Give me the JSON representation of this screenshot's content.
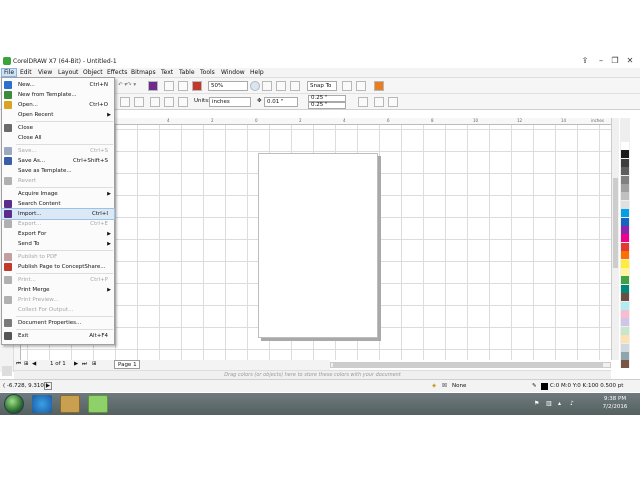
{
  "window": {
    "title": "CorelDRAW X7 (64-Bit) - Untitled-1"
  },
  "menubar": [
    "File",
    "Edit",
    "View",
    "Layout",
    "Object",
    "Effects",
    "Bitmaps",
    "Text",
    "Table",
    "Tools",
    "Window",
    "Help"
  ],
  "toolbar": {
    "zoom": "50%",
    "snap_to": "Snap To",
    "units_label": "Units:",
    "units_value": "inches",
    "nudge": "0.01 \"",
    "dup_x": "0.25 \"",
    "dup_y": "0.25 \""
  },
  "file_menu": [
    {
      "label": "New...",
      "shortcut": "Ctrl+N",
      "icon": "new-document-icon",
      "color": "#2b6fd1"
    },
    {
      "label": "New from Template...",
      "shortcut": "",
      "icon": "template-icon",
      "color": "#3d8a3d"
    },
    {
      "label": "Open...",
      "shortcut": "Ctrl+O",
      "icon": "open-folder-icon",
      "color": "#d9a520"
    },
    {
      "label": "Open Recent",
      "shortcut": "",
      "submenu": true
    },
    {
      "sep": true
    },
    {
      "label": "Close",
      "shortcut": "",
      "icon": "close-doc-icon",
      "color": "#6a6a6a"
    },
    {
      "label": "Close All",
      "shortcut": ""
    },
    {
      "sep": true
    },
    {
      "label": "Save...",
      "shortcut": "Ctrl+S",
      "disabled": true,
      "icon": "save-icon",
      "color": "#9aa8c0"
    },
    {
      "label": "Save As...",
      "shortcut": "Ctrl+Shift+S",
      "icon": "save-as-icon",
      "color": "#3b5da8"
    },
    {
      "label": "Save as Template...",
      "shortcut": ""
    },
    {
      "label": "Revert",
      "shortcut": "",
      "disabled": true,
      "icon": "revert-icon",
      "color": "#b0b0b0"
    },
    {
      "sep": true
    },
    {
      "label": "Acquire Image",
      "shortcut": "",
      "submenu": true
    },
    {
      "label": "Search Content",
      "shortcut": "",
      "icon": "search-content-icon",
      "color": "#5b2d8c"
    },
    {
      "label": "Import...",
      "shortcut": "Ctrl+I",
      "highlight": true,
      "icon": "import-icon",
      "color": "#5b2d8c"
    },
    {
      "label": "Export...",
      "shortcut": "Ctrl+E",
      "disabled": true,
      "icon": "export-icon",
      "color": "#b0b0b0"
    },
    {
      "label": "Export For",
      "shortcut": "",
      "submenu": true
    },
    {
      "label": "Send To",
      "shortcut": "",
      "submenu": true
    },
    {
      "sep": true
    },
    {
      "label": "Publish to PDF",
      "shortcut": "",
      "disabled": true,
      "icon": "pdf-icon",
      "color": "#c0a0a0"
    },
    {
      "label": "Publish Page to ConceptShare...",
      "shortcut": "",
      "icon": "conceptshare-icon",
      "color": "#c0392b"
    },
    {
      "sep": true
    },
    {
      "label": "Print...",
      "shortcut": "Ctrl+P",
      "disabled": true,
      "icon": "print-icon",
      "color": "#b0b0b0"
    },
    {
      "label": "Print Merge",
      "shortcut": "",
      "submenu": true
    },
    {
      "label": "Print Preview...",
      "shortcut": "",
      "disabled": true,
      "icon": "print-preview-icon",
      "color": "#b0b0b0"
    },
    {
      "label": "Collect For Output...",
      "shortcut": "",
      "disabled": true
    },
    {
      "sep": true
    },
    {
      "label": "Document Properties...",
      "shortcut": "",
      "icon": "doc-properties-icon",
      "color": "#7a7a7a"
    },
    {
      "sep": true
    },
    {
      "label": "Exit",
      "shortcut": "Alt+F4",
      "icon": "exit-icon",
      "color": "#555"
    }
  ],
  "ruler": {
    "ticks": [
      "4",
      "2",
      "0",
      "2",
      "4",
      "6",
      "8",
      "10",
      "12",
      "14",
      "16",
      "18",
      "inches"
    ]
  },
  "page_nav": {
    "count": "1 of 1",
    "tab": "Page 1"
  },
  "drag_hint": "Drag colors (or objects) here to store these colors with your document",
  "status": {
    "coords": "( -6.728, 9.310 )",
    "fill": "None",
    "outline": "C:0 M:0 Y:0 K:100  0.500 pt"
  },
  "clock": {
    "time": "9:38 PM",
    "date": "7/2/2016"
  },
  "palette": [
    "#ffffff",
    "#1a1a1a",
    "#3d3d3d",
    "#5e5e5e",
    "#808080",
    "#a0a0a0",
    "#c0c0c0",
    "#e0e0e0",
    "#00a0e9",
    "#1565c0",
    "#8e24aa",
    "#ec008c",
    "#e53935",
    "#ff6f00",
    "#ffeb3b",
    "#fff59d",
    "#43a047",
    "#00897b",
    "#6d4c41",
    "#b2ebf2",
    "#f8bbd0",
    "#d1c4e9",
    "#c8e6c9",
    "#ffe0b2",
    "#cfd8dc",
    "#90a4ae",
    "#795548"
  ]
}
